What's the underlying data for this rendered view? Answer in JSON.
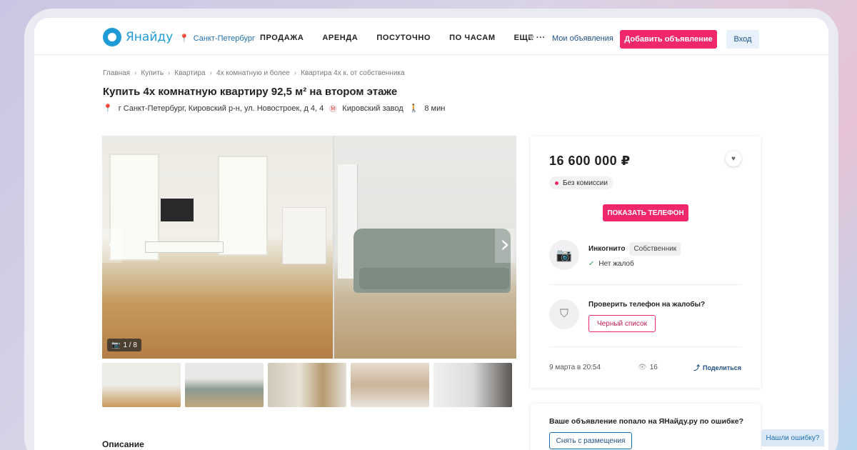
{
  "header": {
    "logo_text": "Янайду",
    "city": "Санкт-Петербург",
    "nav": [
      "ПРОДАЖА",
      "АРЕНДА",
      "ПОСУТОЧНО",
      "ПО ЧАСАМ",
      "ЕЩЕ ···"
    ],
    "my_ads": "Мои объявления",
    "add_button": "Добавить объявление",
    "login_button": "Вход"
  },
  "breadcrumb": [
    "Главная",
    "Купить",
    "Квартира",
    "4х комнатную и более",
    "Квартира 4х к. от собственника"
  ],
  "listing": {
    "title": "Купить 4х комнатную квартиру 92,5 м² на втором этаже",
    "address": "г Санкт-Петербург, Кировский р-н, ул. Новостроек, д 4, 4",
    "metro": "Кировский завод",
    "walk": "8 мин"
  },
  "gallery": {
    "counter": "1 / 8"
  },
  "description_title": "Описание",
  "card": {
    "price": "16 600 000 ₽",
    "commission": "Без комиссии",
    "show_phone": "ПОКАЗАТЬ ТЕЛЕФОН",
    "seller_name": "Инкогнито",
    "seller_tag": "Собственник",
    "no_complaints": "Нет жалоб",
    "check_question": "Проверить телефон на жалобы?",
    "blacklist_button": "Черный список",
    "date": "9 марта в 20:54",
    "views": "16",
    "share": "Поделиться"
  },
  "error_card": {
    "question": "Ваше объявление попало на ЯНайду.ру по ошибке?",
    "remove_button": "Снять с размещения"
  },
  "found_error": "Нашли ошибку?",
  "colors": {
    "accent": "#f0286a",
    "brand": "#1e9ad6",
    "link": "#1e4f86"
  }
}
